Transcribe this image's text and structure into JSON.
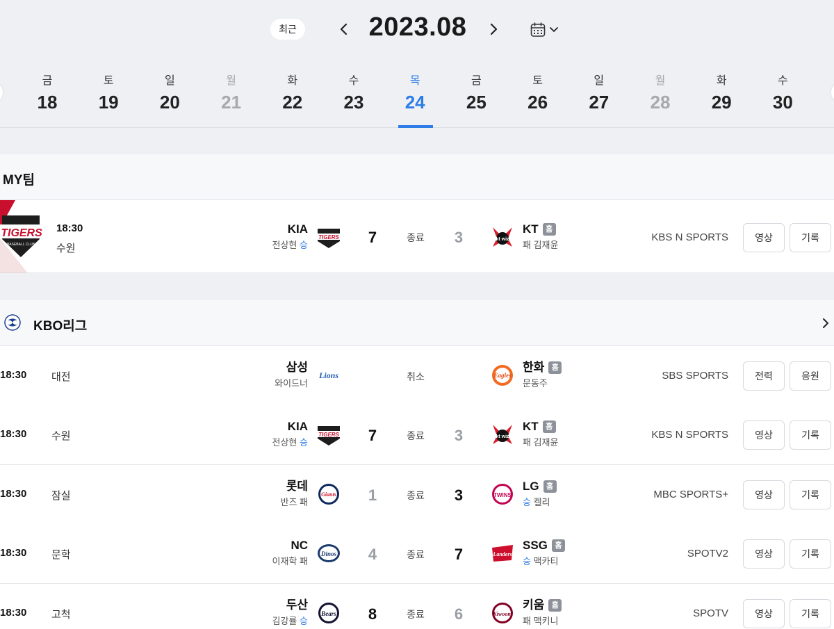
{
  "header": {
    "recent_label": "최근",
    "month_title": "2023.08"
  },
  "days": [
    {
      "dow": "금",
      "num": "18",
      "state": "normal"
    },
    {
      "dow": "토",
      "num": "19",
      "state": "normal"
    },
    {
      "dow": "일",
      "num": "20",
      "state": "normal"
    },
    {
      "dow": "월",
      "num": "21",
      "state": "off"
    },
    {
      "dow": "화",
      "num": "22",
      "state": "normal"
    },
    {
      "dow": "수",
      "num": "23",
      "state": "normal"
    },
    {
      "dow": "목",
      "num": "24",
      "state": "selected"
    },
    {
      "dow": "금",
      "num": "25",
      "state": "normal"
    },
    {
      "dow": "토",
      "num": "26",
      "state": "normal"
    },
    {
      "dow": "일",
      "num": "27",
      "state": "normal"
    },
    {
      "dow": "월",
      "num": "28",
      "state": "off"
    },
    {
      "dow": "화",
      "num": "29",
      "state": "normal"
    },
    {
      "dow": "수",
      "num": "30",
      "state": "normal"
    }
  ],
  "myteam": {
    "section_title": "MY팀",
    "game": {
      "time": "18:30",
      "stadium": "수원",
      "away": {
        "name": "KIA",
        "pitcher": "전상현",
        "result": "승",
        "score": "7"
      },
      "status": "종료",
      "home": {
        "name": "KT",
        "badge": "홈",
        "result": "패",
        "pitcher": "김재윤",
        "score": "3"
      },
      "broadcaster": "KBS N SPORTS",
      "btn1": "영상",
      "btn2": "기록"
    }
  },
  "league": {
    "section_title": "KBO리그",
    "games": [
      {
        "time": "18:30",
        "stadium": "대전",
        "away": {
          "name": "삼성",
          "pitcher": "와이드너",
          "result": "",
          "score": ""
        },
        "status": "취소",
        "home": {
          "name": "한화",
          "badge": "홈",
          "result": "",
          "pitcher": "문동주",
          "score": ""
        },
        "broadcaster": "SBS SPORTS",
        "btn1": "전력",
        "btn2": "응원"
      },
      {
        "time": "18:30",
        "stadium": "수원",
        "away": {
          "name": "KIA",
          "pitcher": "전상현",
          "result": "승",
          "score": "7"
        },
        "status": "종료",
        "home": {
          "name": "KT",
          "badge": "홈",
          "result": "패",
          "pitcher": "김재윤",
          "score": "3"
        },
        "broadcaster": "KBS N SPORTS",
        "btn1": "영상",
        "btn2": "기록"
      },
      {
        "time": "18:30",
        "stadium": "잠실",
        "away": {
          "name": "롯데",
          "pitcher": "반즈",
          "result": "패",
          "score": "1"
        },
        "status": "종료",
        "home": {
          "name": "LG",
          "badge": "홈",
          "result": "승",
          "pitcher": "켈리",
          "score": "3"
        },
        "broadcaster": "MBC SPORTS+",
        "btn1": "영상",
        "btn2": "기록"
      },
      {
        "time": "18:30",
        "stadium": "문학",
        "away": {
          "name": "NC",
          "pitcher": "이재학",
          "result": "패",
          "score": "4"
        },
        "status": "종료",
        "home": {
          "name": "SSG",
          "badge": "홈",
          "result": "승",
          "pitcher": "맥카티",
          "score": "7"
        },
        "broadcaster": "SPOTV2",
        "btn1": "영상",
        "btn2": "기록"
      },
      {
        "time": "18:30",
        "stadium": "고척",
        "away": {
          "name": "두산",
          "pitcher": "김강률",
          "result": "승",
          "score": "8"
        },
        "status": "종료",
        "home": {
          "name": "키움",
          "badge": "홈",
          "result": "패",
          "pitcher": "맥키니",
          "score": "6"
        },
        "broadcaster": "SPOTV",
        "btn1": "영상",
        "btn2": "기록"
      }
    ]
  },
  "logos": {
    "tigers": "TIGERS",
    "baseball_club": "BASEBALL CLUB",
    "ktwiz": "kt wiz",
    "lions": "Lions",
    "eagles": "Eagles",
    "giants": "Giants",
    "twins": "TWINS",
    "dinos": "Dinos",
    "landers": "Landers",
    "bears": "Bears",
    "kiwoom": "Kiwoom"
  },
  "colors": {
    "accent": "#2f7de8",
    "tigers_red": "#c8102e"
  }
}
